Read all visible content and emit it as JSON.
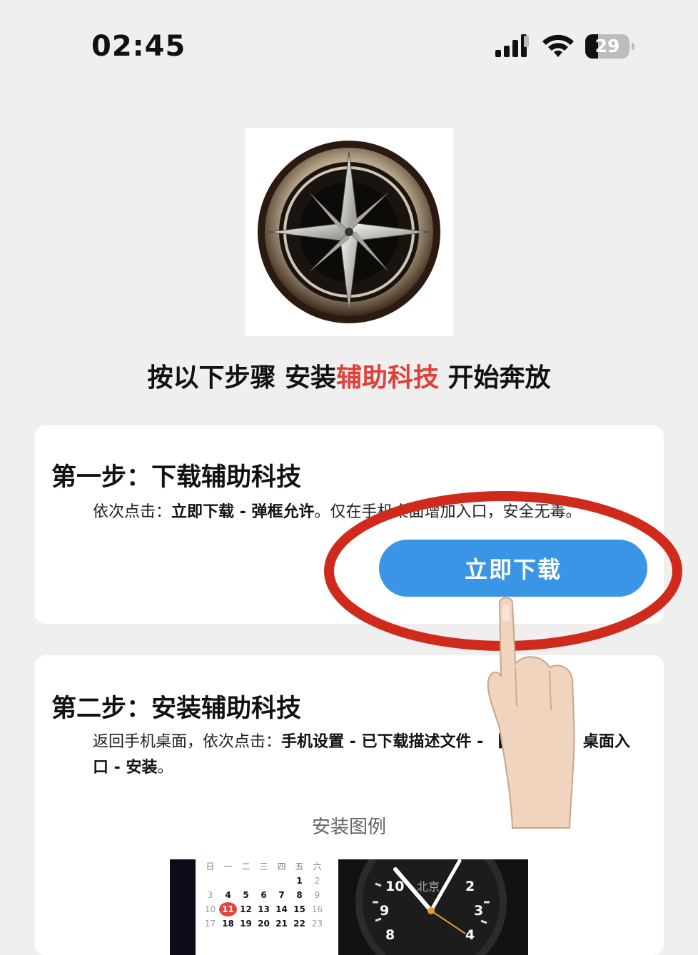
{
  "status_bar": {
    "time": "02:45",
    "battery": "29",
    "battery_level": 0.29
  },
  "headline": {
    "prefix": "按以下步骤 安装",
    "accent": "辅助科技",
    "suffix": " 开始奔放",
    "accent_color": "#e0403c"
  },
  "step1": {
    "title": "第一步：下载辅助科技",
    "desc_prefix": "依次点击：",
    "desc_bold": "立即下载 - 弹框允许",
    "desc_suffix": "。仅在手机桌面增加入口，安全无毒。",
    "button_label": "立即下载",
    "button_color": "#3b95e6"
  },
  "step2": {
    "title": "第二步：安装辅助科技",
    "desc_prefix": "返回手机桌面，依次点击：",
    "desc_bold": "手机设置 - 已下载描述文件 - 【辅助科技】桌面入口 - 安装",
    "desc_suffix": "。",
    "example_caption": "安装图例"
  },
  "calendar_example": {
    "weekday_headers": [
      "日",
      "一",
      "二",
      "三",
      "四",
      "五",
      "六"
    ],
    "rows": [
      [
        "",
        "",
        "",
        "",
        "",
        "1",
        "2"
      ],
      [
        "3",
        "4",
        "5",
        "6",
        "7",
        "8",
        "9"
      ],
      [
        "10",
        "11",
        "12",
        "13",
        "14",
        "15",
        "16"
      ],
      [
        "17",
        "18",
        "19",
        "20",
        "21",
        "22",
        "23"
      ]
    ],
    "today": "11"
  },
  "clock_example": {
    "city": "北京",
    "numerals": [
      "10",
      "2",
      "9",
      "3",
      "8",
      "4"
    ]
  },
  "icons": [
    "app-logo-compass-icon",
    "signal-icon",
    "wifi-icon",
    "battery-icon",
    "pointing-hand-icon",
    "red-circle-highlight"
  ]
}
